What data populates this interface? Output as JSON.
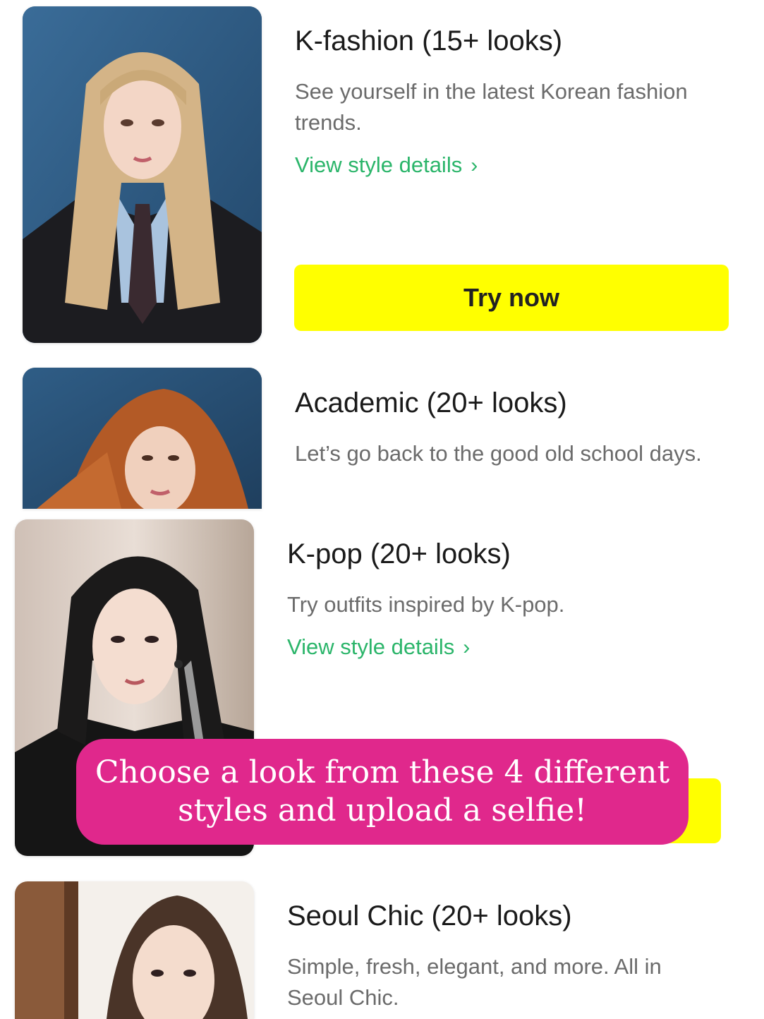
{
  "styles": [
    {
      "title": "K-fashion (15+ looks)",
      "description": "See yourself in the latest Korean fashion trends.",
      "link_label": "View style details",
      "button_label": "Try now"
    },
    {
      "title": "Academic (20+ looks)",
      "description": "Let’s go back to the good old school days."
    },
    {
      "title": "K-pop (20+ looks)",
      "description": "Try outfits inspired by K-pop.",
      "link_label": "View style details"
    },
    {
      "title": "Seoul Chic (20+ looks)",
      "description": "Simple, fresh, elegant, and more. All in Seoul Chic."
    }
  ],
  "banner": {
    "line1": "Choose a look from these 4 different",
    "line2": "styles and upload a selfie!"
  },
  "icons": {
    "link_chevron": "chevron-right-icon"
  },
  "colors": {
    "accent_green": "#2bb56a",
    "button_yellow": "#ffff00",
    "banner_pink": "#e0288c"
  }
}
